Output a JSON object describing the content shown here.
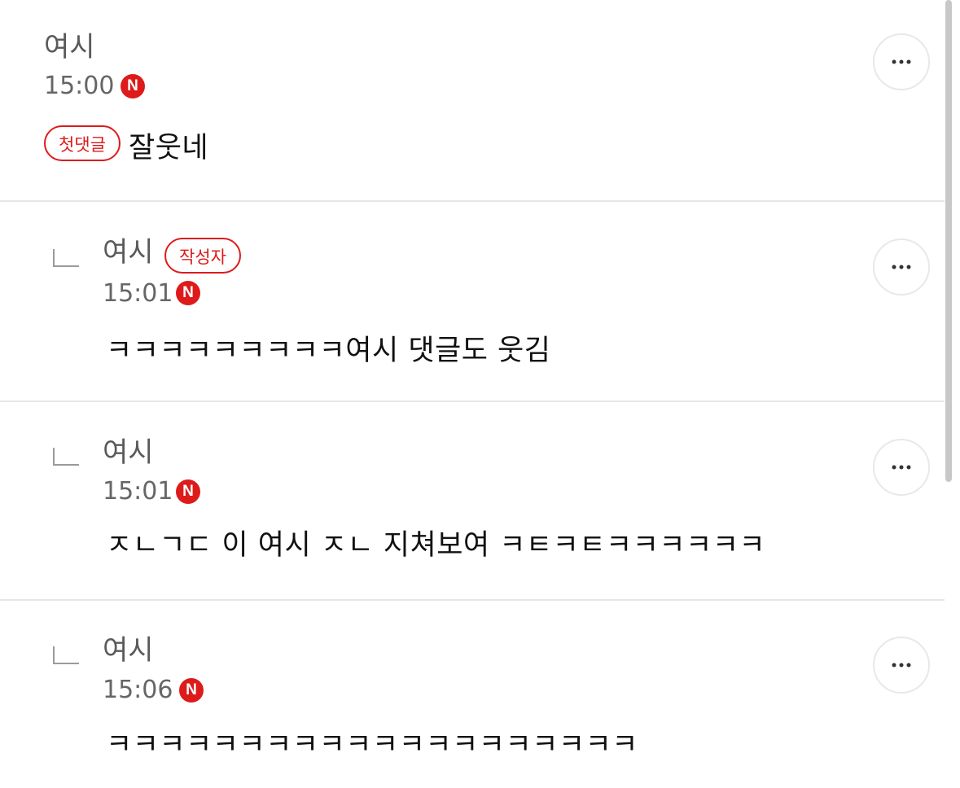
{
  "comments": [
    {
      "author": "여시",
      "time": "15:00",
      "new_badge": "N",
      "tag": "첫댓글",
      "text": "잘웃네"
    },
    {
      "author": "여시",
      "time": "15:01",
      "new_badge": "N",
      "tag": "작성자",
      "text": "ㅋㅋㅋㅋㅋㅋㅋㅋㅋ여시 댓글도 웃김"
    },
    {
      "author": "여시",
      "time": "15:01",
      "new_badge": "N",
      "text": "ㅈㄴㄱㄷ 이 여시 ㅈㄴ 지쳐보여 ㅋㅌㅋㅌㅋㅋㅋㅋㅋㅋ"
    },
    {
      "author": "여시",
      "time": "15:06",
      "new_badge": "N",
      "text": "ㅋㅋㅋㅋㅋㅋㅋㅋㅋㅋㅋㅋㅋㅋㅋㅋㅋㅋㅋㅋ"
    }
  ],
  "icons": {
    "more": "more-horizontal-icon",
    "reply": "reply-arrow-icon"
  },
  "colors": {
    "accent": "#dd1b1b",
    "divider": "#e6e6e6",
    "meta_text": "#666666",
    "body_text": "#111111"
  }
}
